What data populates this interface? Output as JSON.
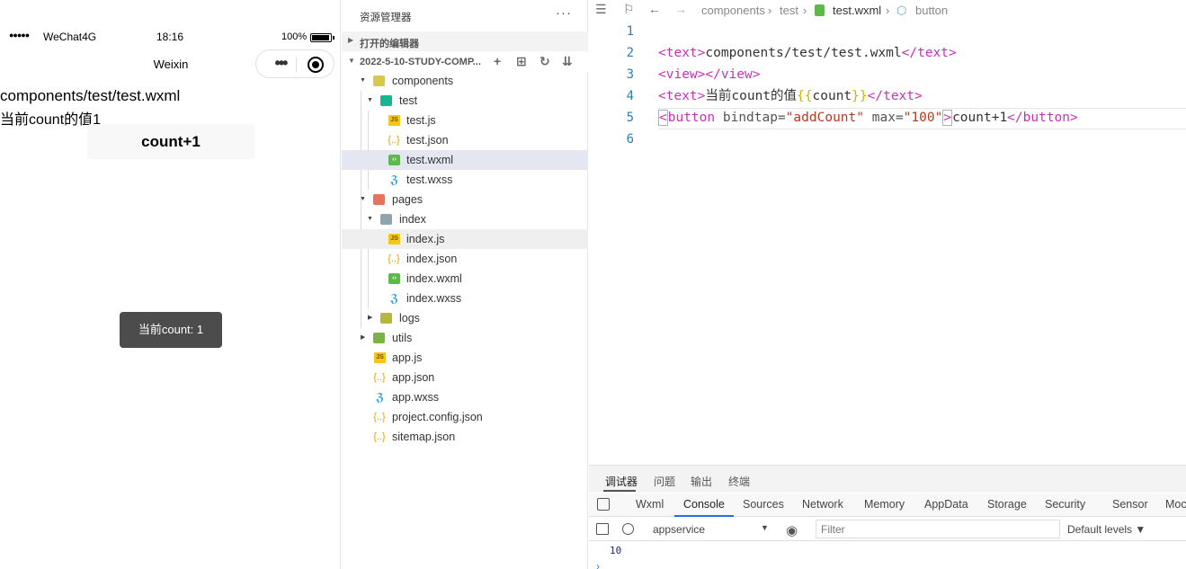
{
  "simulator": {
    "signal": "●●●●●",
    "carrier": "WeChat4G",
    "time": "18:16",
    "battery": "100%",
    "nav_title": "Weixin",
    "capsule_dots": "•••",
    "text_path": "components/test/test.wxml",
    "text_count": "当前count的值1",
    "button_label": "count+1",
    "toast": "当前count: 1"
  },
  "explorer": {
    "title": "资源管理器",
    "more": "···",
    "open_editors": "打开的编辑器",
    "project": "2022-5-10-STUDY-COMP...",
    "tools": [
      "+",
      "⊞",
      "↻",
      "⇊"
    ],
    "items": [
      {
        "name": "components",
        "type": "folder-c",
        "chev": "▼"
      },
      {
        "name": "test",
        "type": "folder-t",
        "chev": "▼"
      },
      {
        "name": "test.js",
        "type": "js"
      },
      {
        "name": "test.json",
        "type": "json"
      },
      {
        "name": "test.wxml",
        "type": "wxml"
      },
      {
        "name": "test.wxss",
        "type": "wxss"
      },
      {
        "name": "pages",
        "type": "folder-p",
        "chev": "▼"
      },
      {
        "name": "index",
        "type": "folder-i",
        "chev": "▼"
      },
      {
        "name": "index.js",
        "type": "js"
      },
      {
        "name": "index.json",
        "type": "json"
      },
      {
        "name": "index.wxml",
        "type": "wxml"
      },
      {
        "name": "index.wxss",
        "type": "wxss"
      },
      {
        "name": "logs",
        "type": "folder-l",
        "chev": "▶"
      },
      {
        "name": "utils",
        "type": "folder-u",
        "chev": "▶"
      },
      {
        "name": "app.js",
        "type": "js"
      },
      {
        "name": "app.json",
        "type": "json"
      },
      {
        "name": "app.wxss",
        "type": "wxss"
      },
      {
        "name": "project.config.json",
        "type": "json"
      },
      {
        "name": "sitemap.json",
        "type": "json"
      }
    ]
  },
  "editor": {
    "breadcrumb": {
      "seg1": "components",
      "seg2": "test",
      "seg3": "test.wxml",
      "seg4": "button",
      "sep": "›"
    },
    "line_numbers": [
      "1",
      "2",
      "3",
      "4",
      "5",
      "6"
    ],
    "code": {
      "l2_open": "<text>",
      "l2_body": "components/test/test.wxml",
      "l2_close": "</text>",
      "l3": "<view></view>",
      "l4_open": "<text>",
      "l4_body": "当前count的值",
      "l4_brace_open": "{{",
      "l4_var": "count",
      "l4_brace_close": "}}",
      "l4_close": "</text>",
      "l5_lt": "<",
      "l5_tag": "button",
      "l5_attr1": " bindtap=",
      "l5_val1": "\"addCount\"",
      "l5_attr2": " max=",
      "l5_val2": "\"100\"",
      "l5_gt": ">",
      "l5_body": "count+1",
      "l5_close": "</button>"
    }
  },
  "panel": {
    "tabs": [
      "调试器",
      "问题",
      "输出",
      "终端"
    ],
    "devtools_tabs": [
      "Wxml",
      "Console",
      "Sources",
      "Network",
      "Memory",
      "AppData",
      "Storage",
      "Security",
      "Sensor",
      "Moc"
    ],
    "context": "appservice",
    "filter_placeholder": "Filter",
    "levels": "Default levels ▼",
    "log_value": "10",
    "prompt": "›"
  }
}
